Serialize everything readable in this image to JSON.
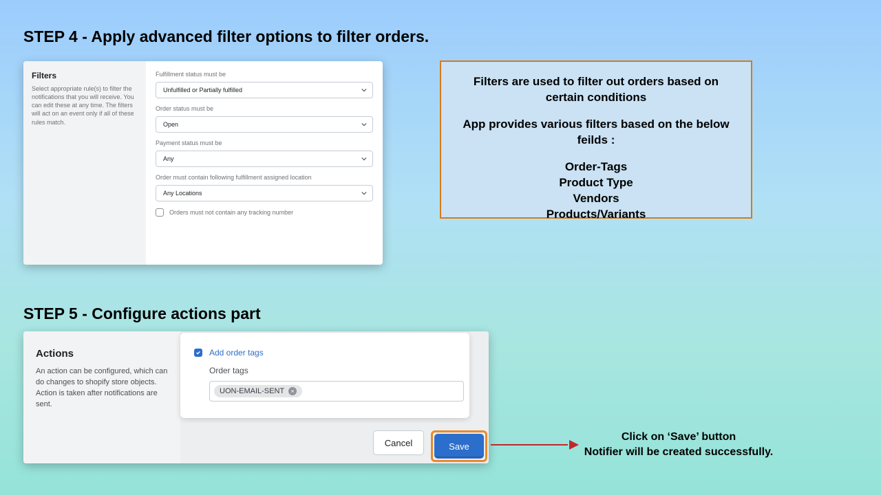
{
  "step4": {
    "title": "STEP 4 - Apply advanced filter options to filter orders.",
    "side_title": "Filters",
    "side_desc": "Select appropriate rule(s) to filter the notifications that you will receive. You can edit these at any time. The filters will act on an event only if all of these rules match.",
    "fields": {
      "fulfillment": {
        "label": "Fulfillment status must be",
        "value": "Unfulfilled or Partially fulfilled"
      },
      "order": {
        "label": "Order status must be",
        "value": "Open"
      },
      "payment": {
        "label": "Payment status must be",
        "value": "Any"
      },
      "location": {
        "label": "Order must contain following fulfillment assigned location",
        "value": "Any Locations"
      }
    },
    "tracking_checkbox": "Orders must not contain any tracking number"
  },
  "callout": {
    "line1": "Filters are used to filter out orders based on",
    "line2": "certain conditions",
    "line3": "App provides various filters based on the below feilds :",
    "item1": "Order-Tags",
    "item2": "Product Type",
    "item3": "Vendors",
    "item4": "Products/Variants"
  },
  "step5": {
    "title": "STEP 5 - Configure actions part",
    "side_title": "Actions",
    "side_desc": "An action can be configured, which can do changes to shopify store objects. Action is taken after notifications are sent.",
    "add_order_tags": "Add order tags",
    "order_tags_label": "Order tags",
    "tag_value": "UON-EMAIL-SENT",
    "cancel": "Cancel",
    "save": "Save"
  },
  "save_instruction": {
    "line1": "Click on ‘Save’ button",
    "line2": "Notifier will be created successfully."
  }
}
